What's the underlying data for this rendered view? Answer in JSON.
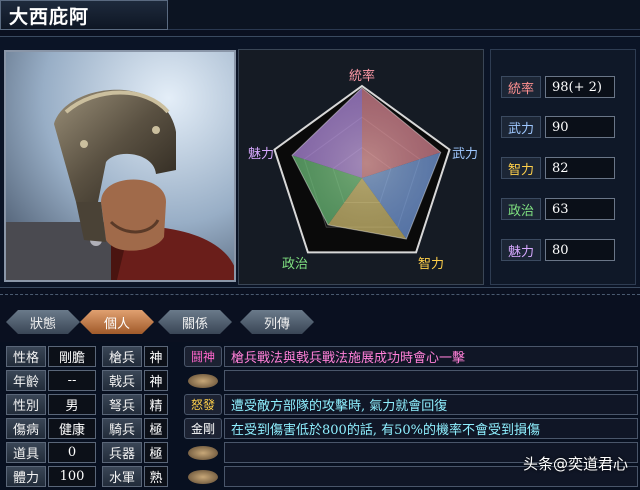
{
  "officer": {
    "name": "大西庇阿"
  },
  "radar": {
    "labels": {
      "top": "統率",
      "right": "武力",
      "bottom_right": "智力",
      "bottom_left": "政治",
      "left": "魅力"
    },
    "values": {
      "leadership": 98,
      "war": 90,
      "intelligence": 82,
      "politics": 63,
      "charisma": 80
    }
  },
  "stats": [
    {
      "label": "統率",
      "value": "98(+ 2)",
      "color": "#ff9090"
    },
    {
      "label": "武力",
      "value": "90",
      "color": "#9fc8ff"
    },
    {
      "label": "智力",
      "value": "82",
      "color": "#ffd04a"
    },
    {
      "label": "政治",
      "value": "63",
      "color": "#7fe080"
    },
    {
      "label": "魅力",
      "value": "80",
      "color": "#d7a8ff"
    }
  ],
  "tabs": [
    {
      "label": "狀態",
      "active": false
    },
    {
      "label": "個人",
      "active": true
    },
    {
      "label": "關係",
      "active": false
    },
    {
      "label": "列傳",
      "active": false
    }
  ],
  "personal": [
    {
      "label": "性格",
      "value": "剛膽"
    },
    {
      "label": "年齡",
      "value": "--"
    },
    {
      "label": "性別",
      "value": "男"
    },
    {
      "label": "傷病",
      "value": "健康"
    },
    {
      "label": "道具",
      "value": "0"
    },
    {
      "label": "體力",
      "value": "100"
    }
  ],
  "aptitudes": [
    {
      "label": "槍兵",
      "value": "神"
    },
    {
      "label": "戟兵",
      "value": "神"
    },
    {
      "label": "弩兵",
      "value": "精"
    },
    {
      "label": "騎兵",
      "value": "極"
    },
    {
      "label": "兵器",
      "value": "極"
    },
    {
      "label": "水軍",
      "value": "熟"
    }
  ],
  "skills": [
    {
      "name": "鬪神",
      "desc": "槍兵戰法與戟兵戰法施展成功時會心一擊",
      "color": "#ff66cc",
      "desc_color": "#ff80d8"
    },
    {
      "name": "",
      "desc": "",
      "color": "#d0b080",
      "desc_color": "#ffffff"
    },
    {
      "name": "怒發",
      "desc": "遭受敵方部隊的攻擊時, 氣力就會回復",
      "color": "#ffd04a",
      "desc_color": "#8ff0ff"
    },
    {
      "name": "金剛",
      "desc": "在受到傷害低於800的話, 有50%的機率不會受到損傷",
      "color": "#ffffff",
      "desc_color": "#8ff0ff"
    },
    {
      "name": "",
      "desc": "",
      "color": "#d0b080",
      "desc_color": "#ffffff"
    },
    {
      "name": "",
      "desc": "",
      "color": "#d0b080",
      "desc_color": "#ffffff"
    }
  ],
  "watermark": "头条@奕道君心"
}
